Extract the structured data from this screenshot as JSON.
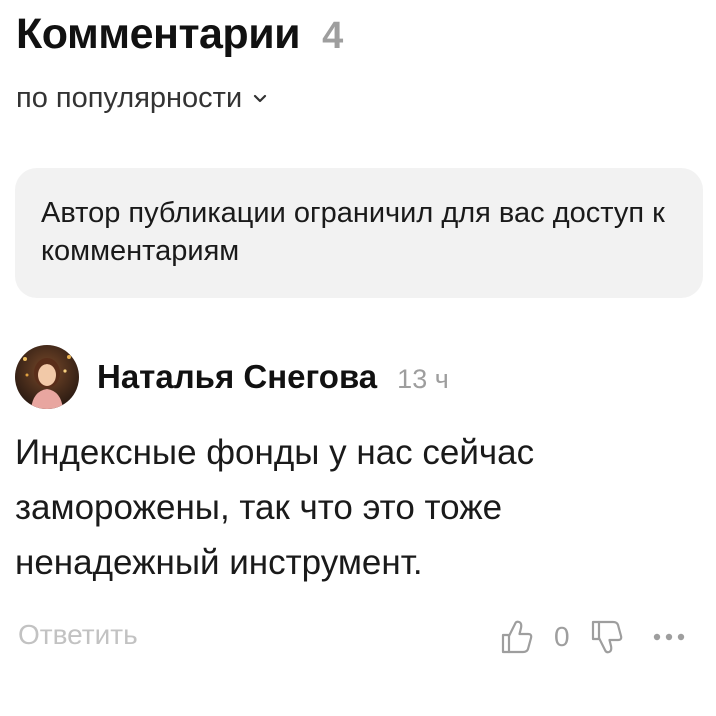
{
  "comments_header": {
    "title": "Комментарии",
    "count": "4"
  },
  "sort": {
    "label": "по популярности",
    "icon": "chevron-down-icon"
  },
  "notice": {
    "text": "Автор публикации ограничил для вас доступ к комментариям"
  },
  "comment": {
    "author": "Наталья Снегова",
    "time": "13 ч",
    "text": "Индексные фонды у нас сейчас заморожены, так что это тоже ненадежный инструмент.",
    "reply_label": "Ответить",
    "likes": "0",
    "icons": [
      "avatar",
      "thumbs-up-icon",
      "thumbs-down-icon",
      "more-icon"
    ]
  },
  "colors": {
    "title": "#111111",
    "muted": "#9e9e9e",
    "reply": "#c2c2c2",
    "notice_bg": "#f2f2f2"
  }
}
